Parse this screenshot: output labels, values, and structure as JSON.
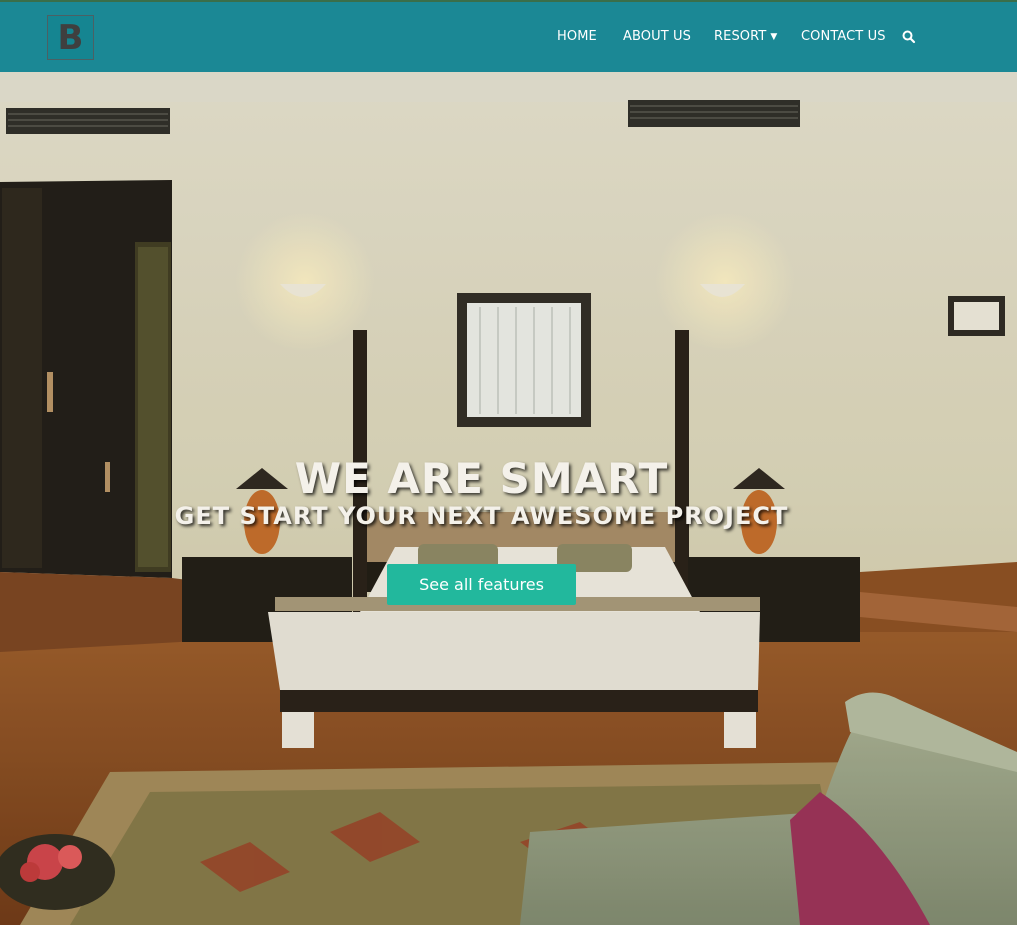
{
  "brand": {
    "logo_letter": "B"
  },
  "nav": {
    "items": [
      {
        "label": "HOME"
      },
      {
        "label": "ABOUT US"
      },
      {
        "label": "RESORT",
        "has_dropdown": true
      },
      {
        "label": "CONTACT US"
      }
    ],
    "search_icon": "search-icon",
    "bar_color": "#1b8895"
  },
  "hero": {
    "title": "WE ARE SMART",
    "subtitle": "GET START YOUR NEXT AWESOME PROJECT",
    "cta_label": "See all features",
    "cta_color": "#22b89d",
    "background_image": "hotel-bedroom-photo"
  }
}
